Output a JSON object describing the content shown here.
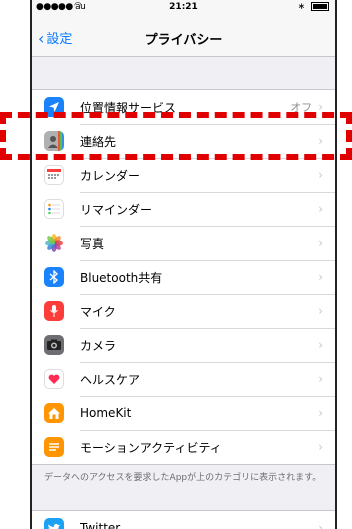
{
  "status": {
    "carrier": "●●●●● au",
    "time": "21:21"
  },
  "nav": {
    "back_label": "設定",
    "title": "プライバシー"
  },
  "rows": [
    {
      "label": "位置情報サービス",
      "value": "オフ",
      "icon": "location-arrow-icon",
      "color": "#1a82fb"
    },
    {
      "label": "連絡先",
      "value": "",
      "icon": "contacts-icon",
      "color": "#9b9b9b"
    },
    {
      "label": "カレンダー",
      "value": "",
      "icon": "calendar-icon",
      "color": "#ffffff"
    },
    {
      "label": "リマインダー",
      "value": "",
      "icon": "reminders-icon",
      "color": "#ffffff"
    },
    {
      "label": "写真",
      "value": "",
      "icon": "photos-icon",
      "color": "#ffffff"
    },
    {
      "label": "Bluetooth共有",
      "value": "",
      "icon": "bluetooth-icon",
      "color": "#1a82fb"
    },
    {
      "label": "マイク",
      "value": "",
      "icon": "microphone-icon",
      "color": "#fc3d39"
    },
    {
      "label": "カメラ",
      "value": "",
      "icon": "camera-icon",
      "color": "#8e8e93"
    },
    {
      "label": "ヘルスケア",
      "value": "",
      "icon": "heart-icon",
      "color": "#ffffff"
    },
    {
      "label": "HomeKit",
      "value": "",
      "icon": "home-icon",
      "color": "#ff9500"
    },
    {
      "label": "モーションアクティビティ",
      "value": "",
      "icon": "motion-icon",
      "color": "#ff9500"
    }
  ],
  "footer_text": "データへのアクセスを要求したAppが上のカテゴリに表示されます。",
  "bottom_row": {
    "label": "Twitter",
    "icon": "twitter-icon",
    "color": "#1da1f2"
  },
  "highlight_color": "#e00000"
}
